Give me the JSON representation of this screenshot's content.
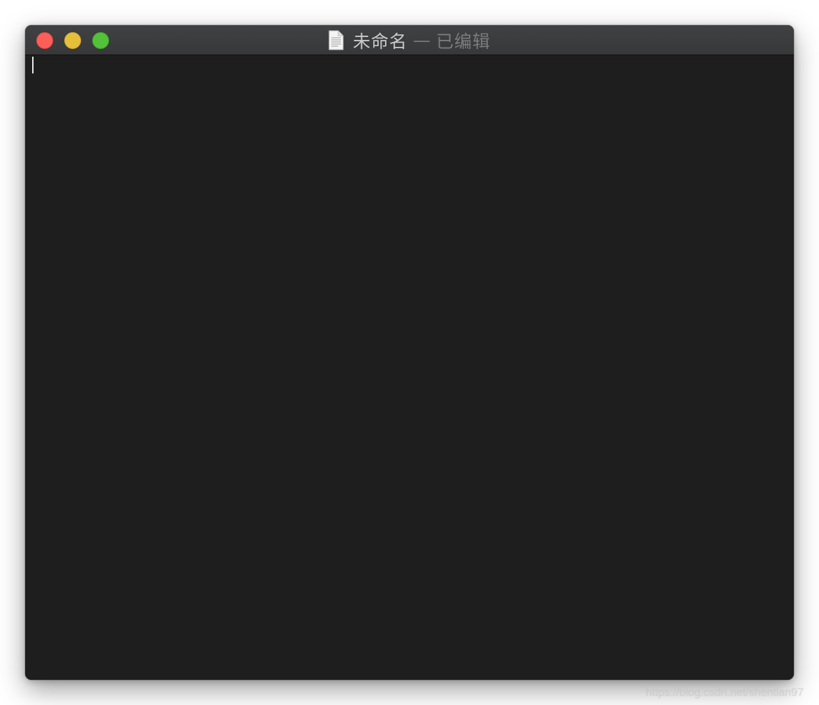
{
  "window": {
    "title_name": "未命名",
    "title_separator": "—",
    "title_status": "已编辑",
    "icon": "document-icon",
    "traffic_lights": {
      "close_color": "#fc5f57",
      "minimize_color": "#e6bf3a",
      "zoom_color": "#54c13b"
    }
  },
  "editor": {
    "content": "",
    "background": "#1e1e1e"
  },
  "watermark": "https://blog.csdn.net/shentian97"
}
